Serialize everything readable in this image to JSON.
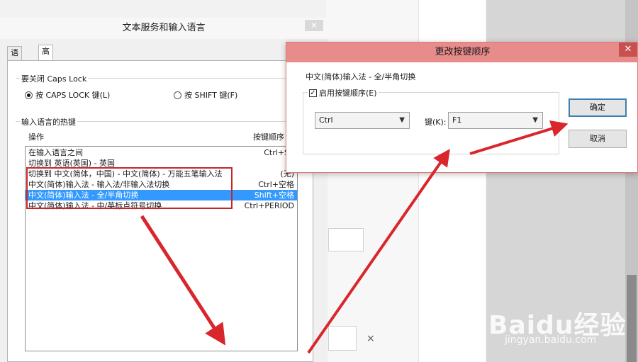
{
  "main_dialog": {
    "title": "文本服务和输入语言",
    "close": "✕",
    "tabs": [
      {
        "label": "语言栏",
        "active": false
      },
      {
        "label": "高级键设置",
        "active": true
      }
    ]
  },
  "caps_group": {
    "title": "要关闭 Caps Lock",
    "option1": "按 CAPS LOCK 键(L)",
    "option2": "按 SHIFT 键(F)",
    "selected": "option1"
  },
  "hotkey_group": {
    "title": "输入语言的热键",
    "col_action": "操作",
    "col_key": "按键顺序",
    "rows": [
      {
        "op": "在输入语言之间",
        "key": "Ctrl+Sh"
      },
      {
        "op": "切换到 英语(英国) - 英国",
        "key": "("
      },
      {
        "op": "切换到 中文(简体，中国) - 中文(简体) - 万能五笔输入法",
        "key": "(无)"
      },
      {
        "op": "中文(简体)输入法 - 输入法/非输入法切换",
        "key": "Ctrl+空格"
      },
      {
        "op": "中文(简体)输入法 - 全/半角切换",
        "key": "Shift+空格"
      },
      {
        "op": "中文(简体)输入法 - 中/英标点符号切换",
        "key": "Ctrl+PERIOD"
      }
    ],
    "selected_index": 4
  },
  "change_dialog": {
    "title": "更改按键顺序",
    "close": "✕",
    "subtitle": "中文(简体)输入法 - 全/半角切换",
    "enable_label": "启用按键顺序(E)",
    "enable_checked": true,
    "modifier_value": "Ctrl",
    "key_label": "键(K):",
    "key_value": "F1",
    "ok_label": "确定",
    "cancel_label": "取消"
  },
  "background": {
    "close_glyph": "×"
  },
  "watermark": {
    "main": "Baidu经验",
    "sub": "jingyan.baidu.com"
  },
  "colors": {
    "highlight": "#3399ff",
    "annotation_red": "#c8252b",
    "dialog2_titlebar": "#e88b8b"
  }
}
